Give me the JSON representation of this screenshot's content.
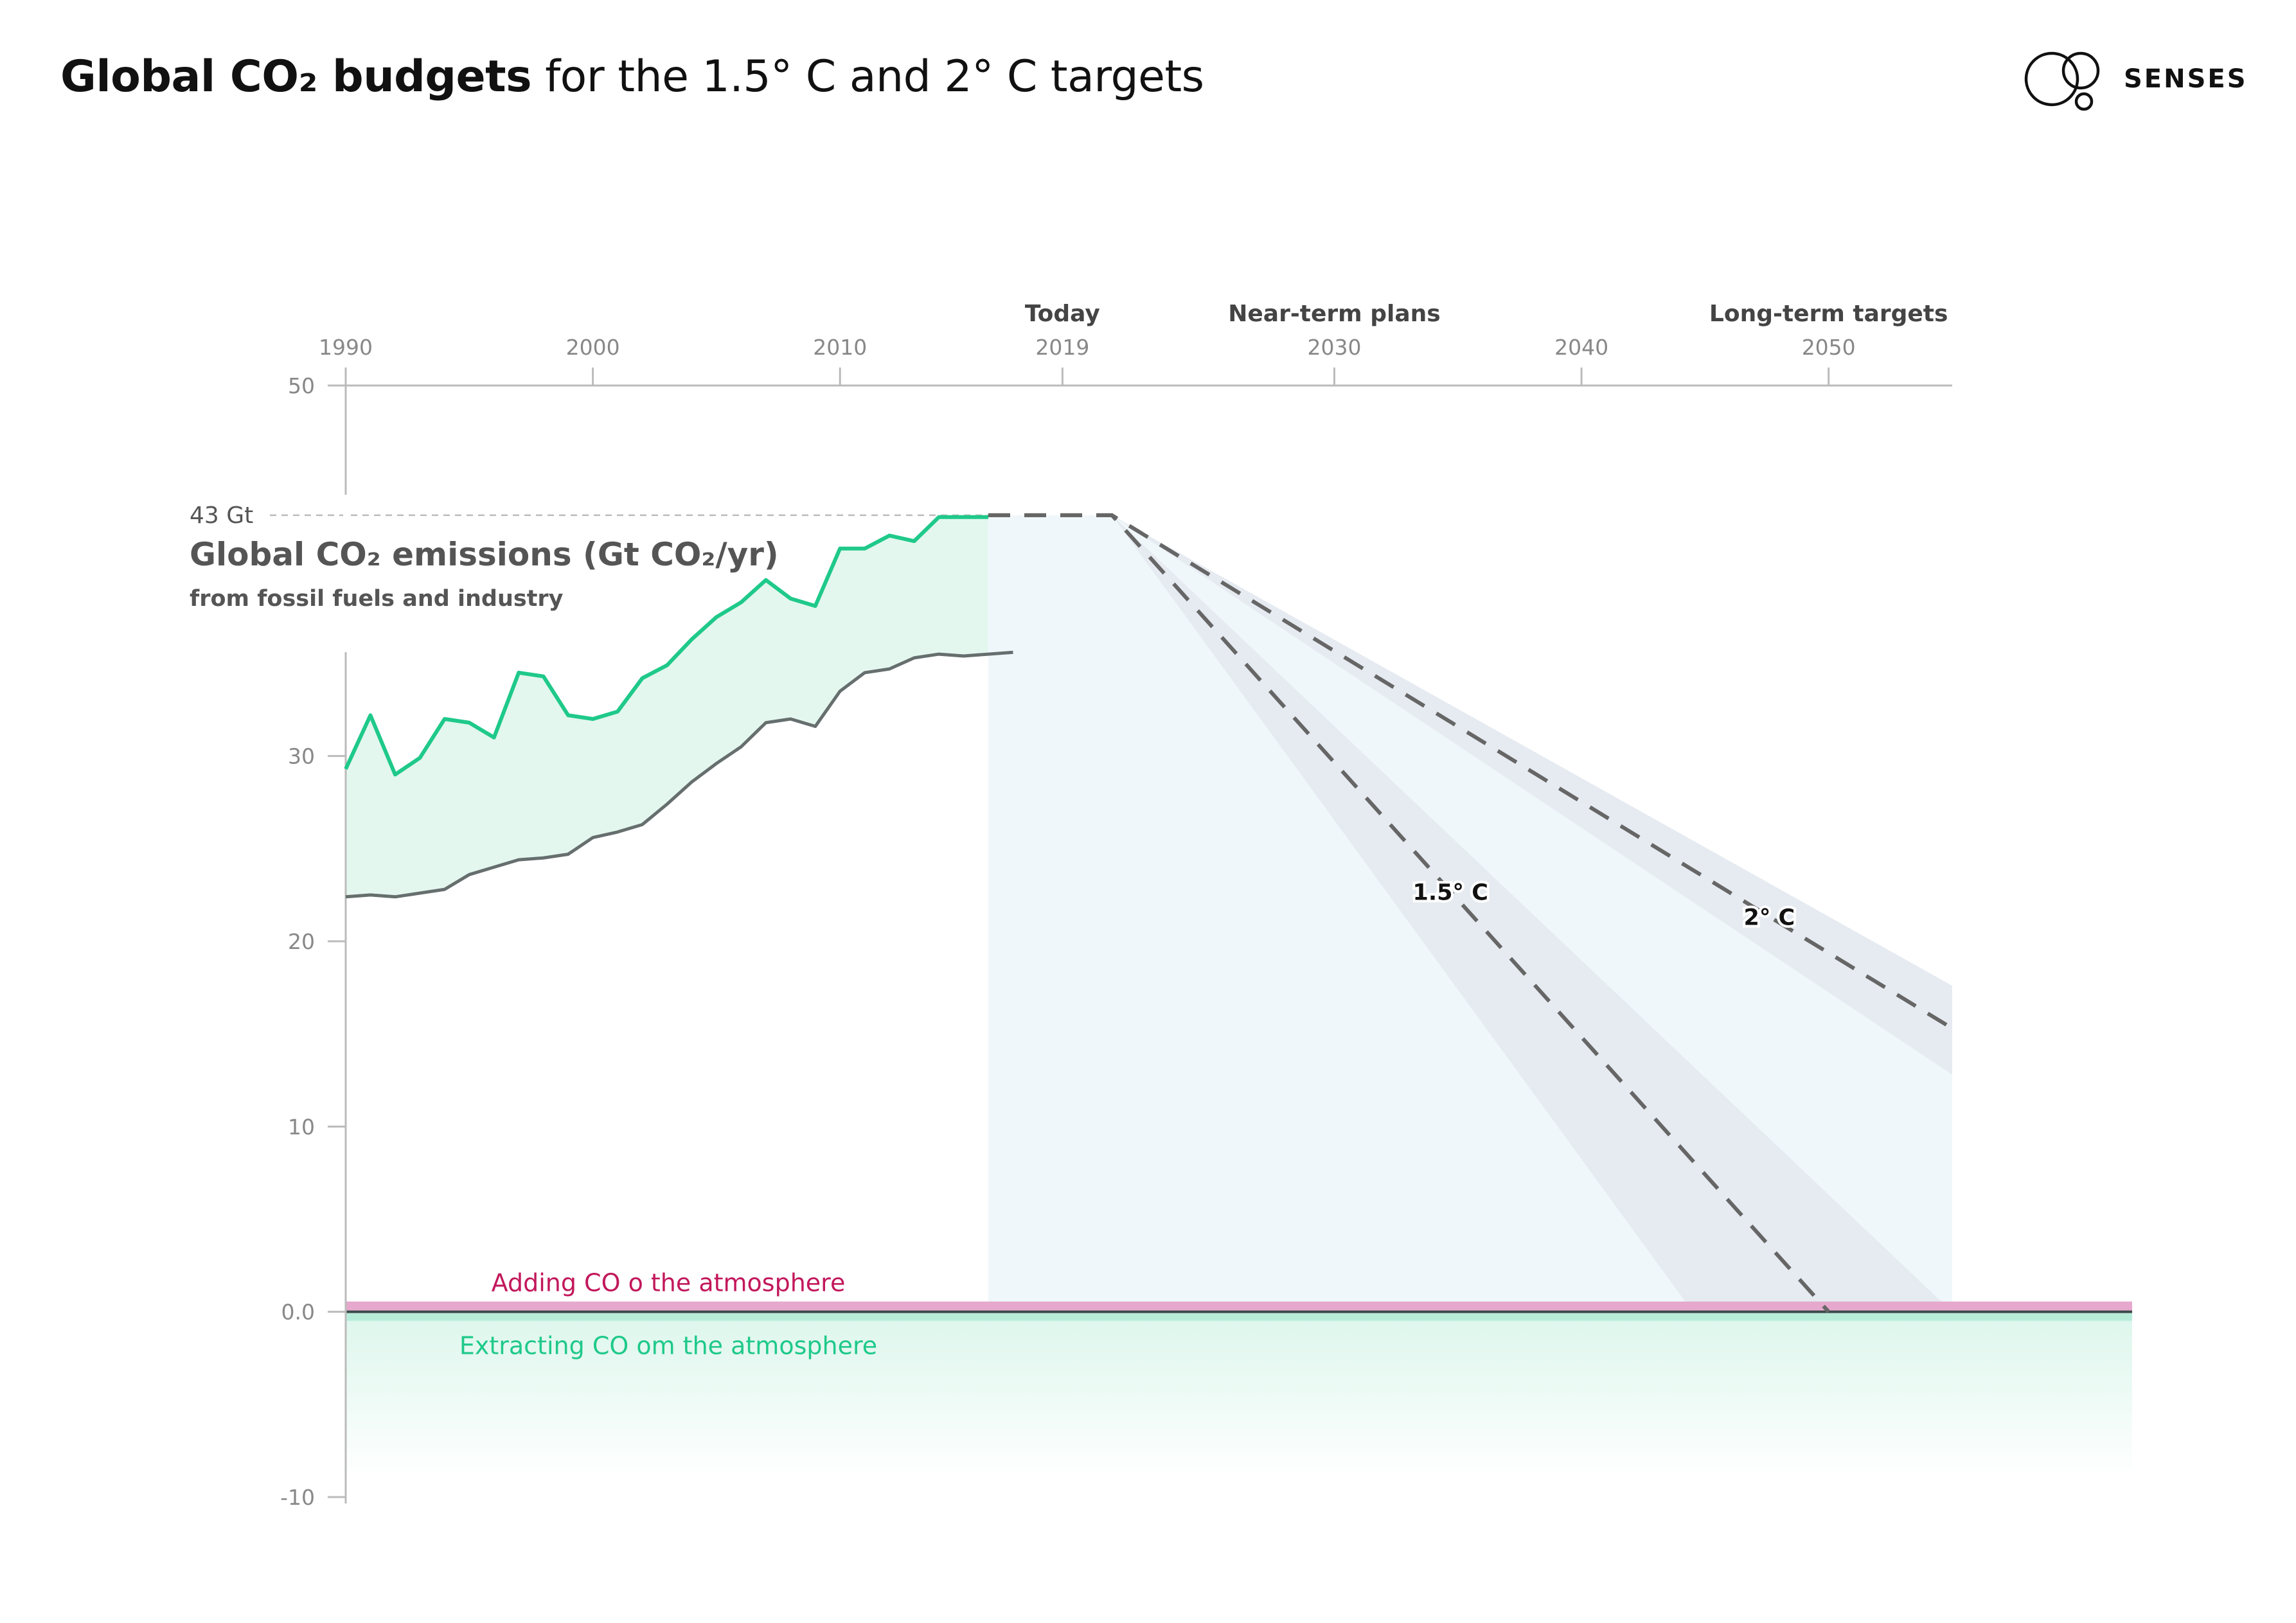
{
  "header": {
    "title_bold": "Global CO₂ budgets",
    "title_rest": " for the 1.5° C and 2° C targets",
    "brand": "SENSES"
  },
  "colors": {
    "emissions_line": "#1fc98a",
    "baseline_line": "#666e6e",
    "history_fill": "#e3f7ee",
    "projection_fill": "#f0f7fb",
    "band_fill": "#e6ebf1",
    "dash": "#666666",
    "adding": "#c2185b",
    "adding_band": "#e6a9cd",
    "extracting": "#1fc98a",
    "axis": "#bbbbbb",
    "tick_text": "#888888"
  },
  "chart_data": {
    "type": "line",
    "xlim": [
      1990,
      2055
    ],
    "ylim": [
      -10,
      50
    ],
    "x_ticks": [
      1990,
      2000,
      2010,
      2019,
      2030,
      2040,
      2050
    ],
    "y_ticks": [
      {
        "value": 50,
        "label": "50"
      },
      {
        "value": 30,
        "label": "30"
      },
      {
        "value": 20,
        "label": "20"
      },
      {
        "value": 10,
        "label": "10"
      },
      {
        "value": 0,
        "label": "0.0"
      },
      {
        "value": -10,
        "label": "-10"
      }
    ],
    "header_labels": [
      {
        "x": 2019,
        "label": "Today"
      },
      {
        "x": 2030,
        "label": "Near-term plans"
      },
      {
        "x": 2050,
        "label": "Long-term targets"
      }
    ],
    "reference": {
      "value": 43,
      "label": "43 Gt"
    },
    "ylabel": "Global CO₂ emissions (Gt CO₂/yr)",
    "ylabel_sub": "from fossil fuels and industry",
    "series": [
      {
        "x": [
          1990,
          1991,
          1992,
          1993,
          1994,
          1995,
          1996,
          1997,
          1998,
          1999,
          2000,
          2001,
          2002,
          2003,
          2004,
          2005,
          2006,
          2007,
          2008,
          2009,
          2010,
          2011,
          2012,
          2013,
          2014,
          2015,
          2016
        ],
        "values": [
          29.3,
          32.2,
          29.0,
          29.9,
          32.0,
          31.8,
          31.0,
          34.5,
          34.3,
          32.2,
          32.0,
          32.4,
          34.2,
          34.9,
          36.3,
          37.5,
          38.3,
          39.5,
          38.5,
          38.1,
          41.2,
          41.2,
          41.9,
          41.6,
          42.9,
          42.9,
          42.9
        ]
      },
      {
        "x": [
          1990,
          1991,
          1992,
          1993,
          1994,
          1995,
          1996,
          1997,
          1998,
          1999,
          2000,
          2001,
          2002,
          2003,
          2004,
          2005,
          2006,
          2007,
          2008,
          2009,
          2010,
          2011,
          2012,
          2013,
          2014,
          2015,
          2016,
          2017
        ],
        "values": [
          22.4,
          22.5,
          22.4,
          22.6,
          22.8,
          23.6,
          24.0,
          24.4,
          24.5,
          24.7,
          25.6,
          25.9,
          26.3,
          27.4,
          28.6,
          29.6,
          30.5,
          31.8,
          32.0,
          31.6,
          33.5,
          34.5,
          34.7,
          35.3,
          35.5,
          35.4,
          35.5,
          35.6
        ]
      }
    ],
    "projections": [
      {
        "name": "1.5° C",
        "x": [
          2016,
          2021,
          2050
        ],
        "values": [
          43,
          43,
          0
        ],
        "band_upper": [
          43,
          43,
          0
        ],
        "band_upper_end": [
          2055,
          0
        ],
        "band_lower_end": [
          2044.5,
          0
        ]
      },
      {
        "name": "2° C",
        "x": [
          2016,
          2021,
          2055
        ],
        "values": [
          43,
          43,
          15.3
        ],
        "band_upper": [
          2055,
          17.6
        ],
        "band_lower": [
          2055,
          12.8
        ]
      }
    ],
    "zones": [
      {
        "label": "Adding CO o the atmosphere"
      },
      {
        "label": "Extracting CO om the atmosphere"
      }
    ]
  }
}
